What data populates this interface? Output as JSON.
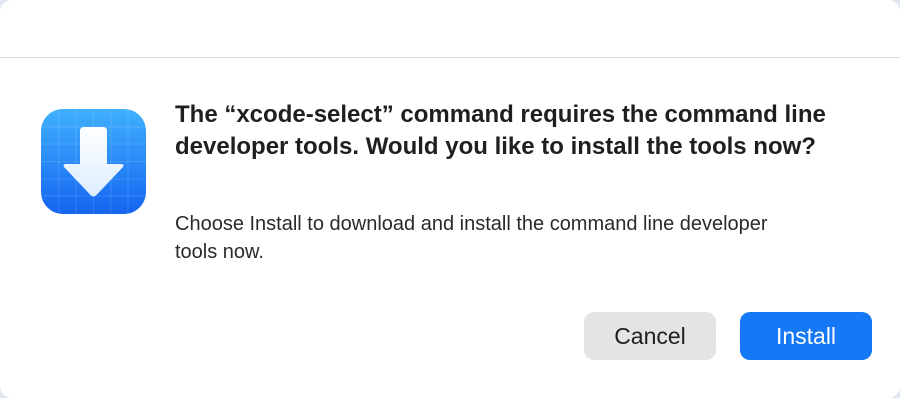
{
  "dialog": {
    "headline": "The “xcode-select” command requires the command line developer tools. Would you like to install the tools now?",
    "body": "Choose Install to download and install the command line developer tools now.",
    "icon": "download-arrow-icon",
    "buttons": {
      "cancel_label": "Cancel",
      "install_label": "Install"
    }
  },
  "colors": {
    "accent": "#1578f5",
    "icon_gradient_top": "#3fb0ff",
    "icon_gradient_bottom": "#1565f0",
    "secondary_button": "#e4e4e4"
  }
}
